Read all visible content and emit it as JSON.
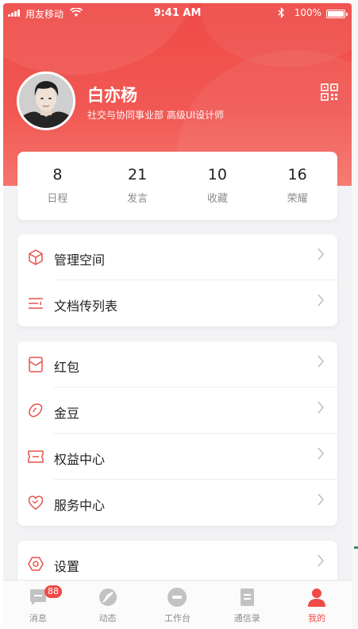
{
  "status_bar": {
    "carrier": "用友移动",
    "time": "9:41 AM",
    "battery": "100%"
  },
  "profile": {
    "name": "白亦杨",
    "department": "社交与协同事业部 高级UI设计师"
  },
  "stats": [
    {
      "value": "8",
      "label": "日程"
    },
    {
      "value": "21",
      "label": "发言"
    },
    {
      "value": "10",
      "label": "收藏"
    },
    {
      "value": "16",
      "label": "荣耀"
    }
  ],
  "group1": [
    {
      "label": "管理空间",
      "icon": "cube-icon"
    },
    {
      "label": "文档传列表",
      "icon": "list-icon"
    }
  ],
  "group2": [
    {
      "label": "红包",
      "icon": "red-envelope-icon"
    },
    {
      "label": "金豆",
      "icon": "bean-icon"
    },
    {
      "label": "权益中心",
      "icon": "ticket-icon"
    },
    {
      "label": "服务中心",
      "icon": "heart-icon"
    }
  ],
  "group3": [
    {
      "label": "设置",
      "icon": "settings-icon"
    }
  ],
  "tabs": [
    {
      "label": "消息",
      "badge": "88",
      "icon": "message-icon"
    },
    {
      "label": "动态",
      "icon": "feather-icon"
    },
    {
      "label": "工作台",
      "icon": "workbench-icon"
    },
    {
      "label": "通信录",
      "icon": "contacts-icon"
    },
    {
      "label": "我的",
      "icon": "user-icon",
      "active": true
    }
  ],
  "colors": {
    "accent": "#ef4a47",
    "icon_red": "#e6524c",
    "text": "#222222",
    "muted": "#8c8c8c",
    "background": "#f3f3f5"
  }
}
